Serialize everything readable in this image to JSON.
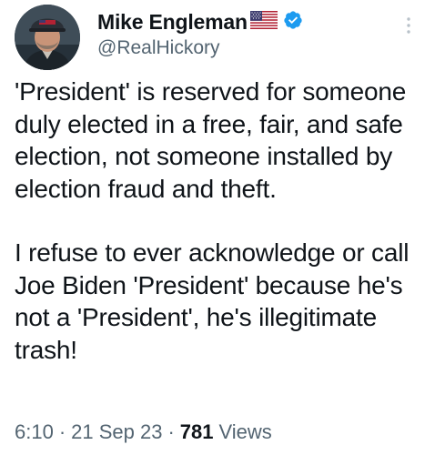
{
  "author": {
    "display_name": "Mike Engleman",
    "handle": "@RealHickory",
    "flag_icon": "us-flag-icon",
    "verified_icon": "verified-badge-icon",
    "verified_color": "#1d9bf0"
  },
  "tweet": {
    "paragraphs": [
      "'President' is reserved for someone duly elected in a free, fair, and safe election, not someone installed by election fraud and theft.",
      "I refuse to ever acknowledge or call Joe Biden 'President' because he's not a 'President', he's illegitimate trash!"
    ]
  },
  "meta": {
    "time": "6:10",
    "date": "21 Sep 23",
    "views_count": "781",
    "views_label": "Views",
    "separator": "·"
  },
  "colors": {
    "text_primary": "#0f1419",
    "text_secondary": "#536471"
  }
}
